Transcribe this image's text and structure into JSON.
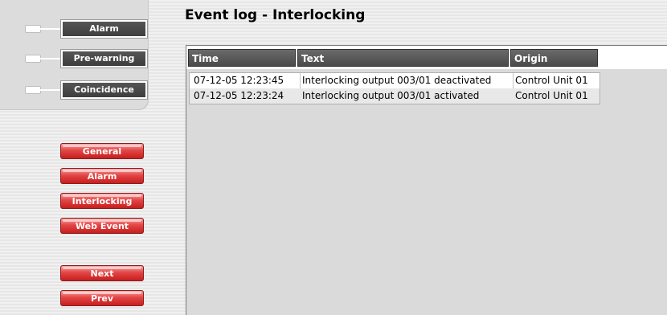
{
  "page": {
    "title": "Event log - Interlocking"
  },
  "status": {
    "items": [
      {
        "label": "Alarm"
      },
      {
        "label": "Pre-warning"
      },
      {
        "label": "Coincidence"
      }
    ]
  },
  "nav": {
    "buttons": [
      {
        "label": "General"
      },
      {
        "label": "Alarm"
      },
      {
        "label": "Interlocking"
      },
      {
        "label": "Web Event"
      }
    ],
    "next_label": "Next",
    "prev_label": "Prev"
  },
  "table": {
    "columns": [
      "Time",
      "Text",
      "Origin"
    ],
    "rows": [
      {
        "time": "07-12-05 12:23:45",
        "text": "Interlocking output 003/01 deactivated",
        "origin": "Control Unit 01"
      },
      {
        "time": "07-12-05 12:23:24",
        "text": "Interlocking output 003/01 activated",
        "origin": "Control Unit 01"
      }
    ]
  },
  "colors": {
    "accent_red": "#d83535",
    "header_gray": "#555555",
    "indicator_off": "#ffffff"
  }
}
